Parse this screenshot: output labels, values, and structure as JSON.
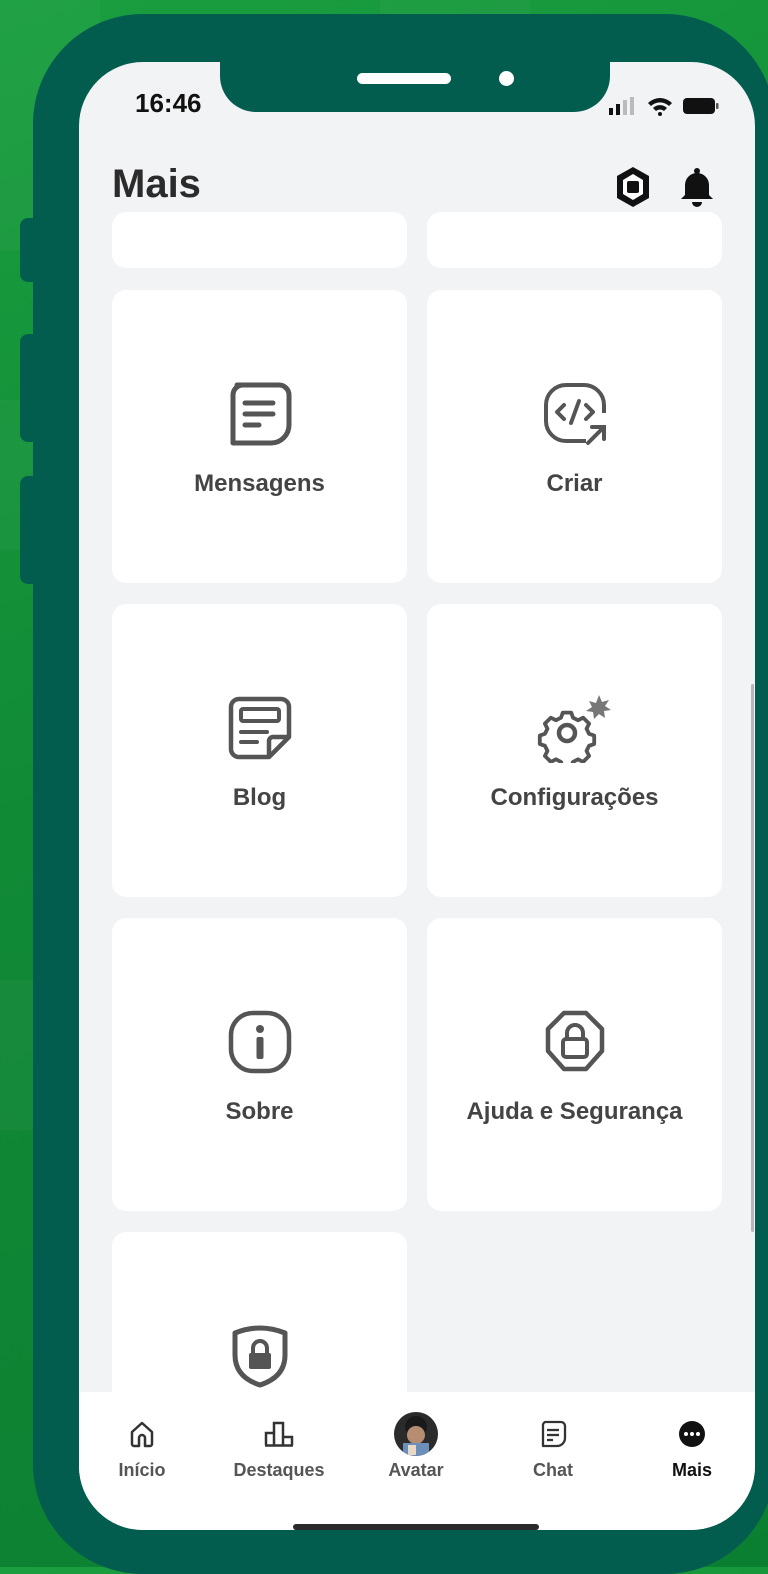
{
  "status_bar": {
    "time": "16:46"
  },
  "header": {
    "title": "Mais",
    "robux_icon": "robux-icon",
    "bell_icon": "bell-icon"
  },
  "menu": {
    "items": [
      {
        "label": "Mensagens",
        "icon": "message-icon"
      },
      {
        "label": "Criar",
        "icon": "code-create-icon"
      },
      {
        "label": "Blog",
        "icon": "blog-icon"
      },
      {
        "label": "Configurações",
        "icon": "gear-icon"
      },
      {
        "label": "Sobre",
        "icon": "info-icon"
      },
      {
        "label": "Ajuda e Segurança",
        "icon": "shield-lock-icon"
      },
      {
        "label": "",
        "icon": "parental-shield-icon"
      }
    ]
  },
  "tabbar": {
    "tabs": [
      {
        "label": "Início",
        "icon": "home-icon"
      },
      {
        "label": "Destaques",
        "icon": "charts-icon"
      },
      {
        "label": "Avatar",
        "icon": "avatar-icon"
      },
      {
        "label": "Chat",
        "icon": "chat-icon"
      },
      {
        "label": "Mais",
        "icon": "more-icon",
        "active": true
      }
    ]
  },
  "colors": {
    "background_green": "#119039",
    "phone_frame": "#035d4f",
    "screen_bg": "#f2f3f5"
  }
}
